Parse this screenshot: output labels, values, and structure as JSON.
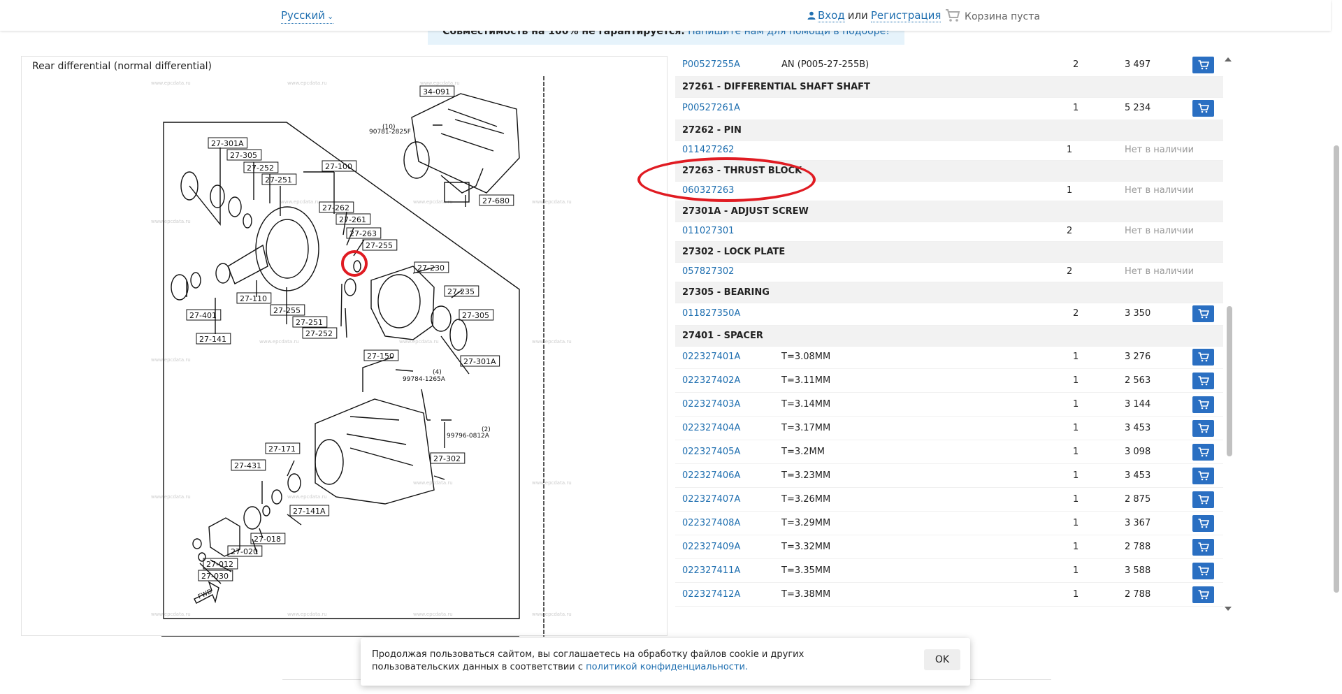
{
  "header": {
    "language": "Русский",
    "login": "Вход",
    "or": "или",
    "register": "Регистрация",
    "cart": "Корзина пуста"
  },
  "notice": {
    "strong": "Совместимость на 100% не гарантируется.",
    "link": "Напишите нам для помощи в подборе!"
  },
  "diagram": {
    "title": "Rear differential (normal differential)",
    "watermark": "www.epcdata.ru",
    "labels": [
      "34-091",
      "90781-2825F",
      "(10)",
      "27-301A",
      "27-305",
      "27-252",
      "27-251",
      "27-100",
      "27-262",
      "27-261",
      "27-263",
      "27-255",
      "27-230",
      "27-235",
      "27-305",
      "27-110",
      "27-255",
      "27-401",
      "27-251",
      "27-252",
      "27-141",
      "27-680",
      "27-150",
      "99784-1265A",
      "(4)",
      "27-301A",
      "27-171",
      "27-431",
      "27-141A",
      "27-018",
      "27-020",
      "27-012",
      "27-030",
      "99796-0812A",
      "(2)",
      "27-302",
      "FWD"
    ]
  },
  "parts": {
    "rows": [
      {
        "type": "item",
        "num": "P00527255A",
        "desc": "AN (P005-27-255B)",
        "qty": "2",
        "price": "3 497",
        "cart": true
      },
      {
        "type": "header",
        "title": "27261 - DIFFERENTIAL SHAFT SHAFT"
      },
      {
        "type": "item",
        "num": "P00527261A",
        "desc": "",
        "qty": "1",
        "price": "5 234",
        "cart": true
      },
      {
        "type": "header",
        "title": "27262 - PIN"
      },
      {
        "type": "item",
        "num": "011427262",
        "desc": "",
        "qty": "1",
        "na": "Нет в наличии"
      },
      {
        "type": "header",
        "title": "27263 - THRUST BLOCK"
      },
      {
        "type": "item",
        "num": "060327263",
        "desc": "",
        "qty": "1",
        "na": "Нет в наличии"
      },
      {
        "type": "header",
        "title": "27301A - ADJUST SCREW"
      },
      {
        "type": "item",
        "num": "011027301",
        "desc": "",
        "qty": "2",
        "na": "Нет в наличии"
      },
      {
        "type": "header",
        "title": "27302 - LOCK PLATE"
      },
      {
        "type": "item",
        "num": "057827302",
        "desc": "",
        "qty": "2",
        "na": "Нет в наличии"
      },
      {
        "type": "header",
        "title": "27305 - BEARING"
      },
      {
        "type": "item",
        "num": "011827350A",
        "desc": "",
        "qty": "2",
        "price": "3 350",
        "cart": true
      },
      {
        "type": "header",
        "title": "27401 - SPACER"
      },
      {
        "type": "item",
        "num": "022327401A",
        "desc": "T=3.08MM",
        "qty": "1",
        "price": "3 276",
        "cart": true
      },
      {
        "type": "item",
        "num": "022327402A",
        "desc": "T=3.11MM",
        "qty": "1",
        "price": "2 563",
        "cart": true
      },
      {
        "type": "item",
        "num": "022327403A",
        "desc": "T=3.14MM",
        "qty": "1",
        "price": "3 144",
        "cart": true
      },
      {
        "type": "item",
        "num": "022327404A",
        "desc": "T=3.17MM",
        "qty": "1",
        "price": "3 453",
        "cart": true
      },
      {
        "type": "item",
        "num": "022327405A",
        "desc": "T=3.2MM",
        "qty": "1",
        "price": "3 098",
        "cart": true
      },
      {
        "type": "item",
        "num": "022327406A",
        "desc": "T=3.23MM",
        "qty": "1",
        "price": "3 453",
        "cart": true
      },
      {
        "type": "item",
        "num": "022327407A",
        "desc": "T=3.26MM",
        "qty": "1",
        "price": "2 875",
        "cart": true
      },
      {
        "type": "item",
        "num": "022327408A",
        "desc": "T=3.29MM",
        "qty": "1",
        "price": "3 367",
        "cart": true
      },
      {
        "type": "item",
        "num": "022327409A",
        "desc": "T=3.32MM",
        "qty": "1",
        "price": "2 788",
        "cart": true
      },
      {
        "type": "item",
        "num": "022327411A",
        "desc": "T=3.35MM",
        "qty": "1",
        "price": "3 588",
        "cart": true
      },
      {
        "type": "item",
        "num": "022327412A",
        "desc": "T=3.38MM",
        "qty": "1",
        "price": "2 788",
        "cart": true
      }
    ]
  },
  "cookie": {
    "text": "Продолжая пользоваться сайтом, вы соглашаетесь на обработку файлов cookie и других пользовательских данных в соответствии с ",
    "link": "политикой конфиденциальности.",
    "ok": "OK"
  },
  "colors": {
    "accent": "#2a6fc2",
    "link": "#1f6fb0",
    "highlight": "#e01b22",
    "header_bg": "#f2f2f2"
  },
  "icons": [
    "user-icon",
    "cart-icon",
    "chevron-down-icon",
    "add-to-cart-icon"
  ]
}
